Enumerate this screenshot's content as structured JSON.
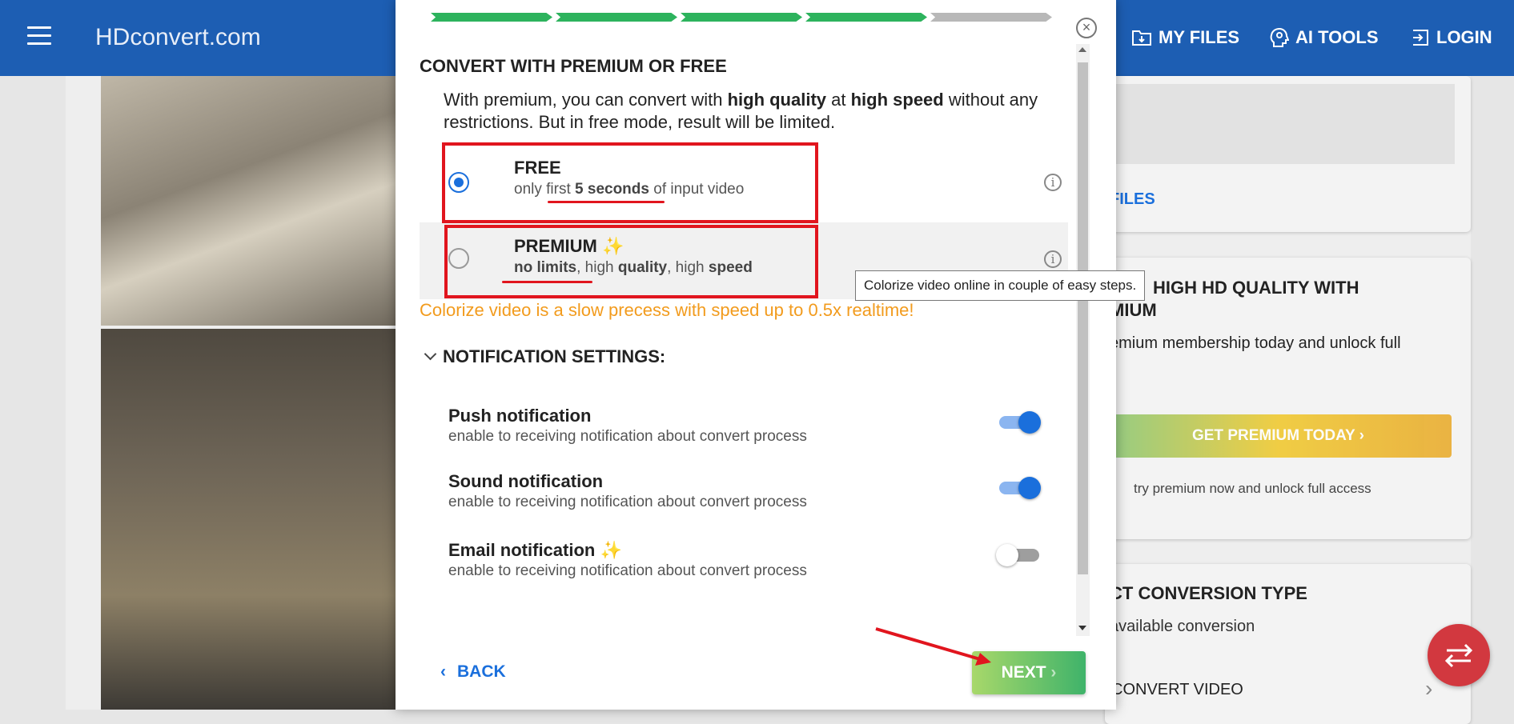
{
  "appbar": {
    "brand": "HDconvert.com",
    "nav": [
      "MY FILES",
      "AI TOOLS",
      "LOGIN"
    ]
  },
  "background_right": {
    "files_link": "FILES",
    "premium_title_line1": "HIGH HD QUALITY WITH",
    "premium_title_line2": "MIUM",
    "premium_text": "emium membership today and unlock full",
    "get_premium": "GET PREMIUM TODAY",
    "try_premium": "try premium now and unlock full access",
    "conversion_title": "CT CONVERSION TYPE",
    "conversion_sub": "available conversion",
    "convert_video": "CONVERT VIDEO"
  },
  "modal": {
    "progress": {
      "total_steps": 5,
      "completed_steps": 4
    },
    "heading": "CONVERT WITH PREMIUM OR FREE",
    "intro": {
      "p1": "With premium, you can convert with ",
      "b1": "high quality",
      "p2": " at ",
      "b2": "high speed",
      "p3": " without any restrictions. But in free mode, result will be limited."
    },
    "free": {
      "title": "FREE",
      "selected": true,
      "sub_a": "only ",
      "sub_b": "first ",
      "sub_c": "5 seconds",
      "sub_d": " of input video"
    },
    "premium": {
      "title": "PREMIUM",
      "selected": false,
      "sub_a": "no limits",
      "sub_b": ", high ",
      "sub_c": "quality",
      "sub_d": ", high ",
      "sub_e": "speed"
    },
    "tooltip": "Colorize video online in couple of easy steps.",
    "warning": "Colorize video is a slow precess with speed up to 0.5x realtime!",
    "notif_heading": "NOTIFICATION SETTINGS:",
    "notifications": [
      {
        "title": "Push notification",
        "desc": "enable to receiving notification about convert process",
        "enabled": true
      },
      {
        "title": "Sound notification",
        "desc": "enable to receiving notification about convert process",
        "enabled": true
      },
      {
        "title": "Email notification",
        "desc": "enable to receiving notification about convert process",
        "enabled": false
      }
    ],
    "back_label": "BACK",
    "next_label": "NEXT"
  },
  "colors": {
    "appbar": "#1d5eb3",
    "step_done": "#2db35d",
    "step_todo": "#b8b8b8",
    "accent_blue": "#1a6fdc",
    "warning": "#f29b1d",
    "annotation_red": "#e1151e"
  }
}
